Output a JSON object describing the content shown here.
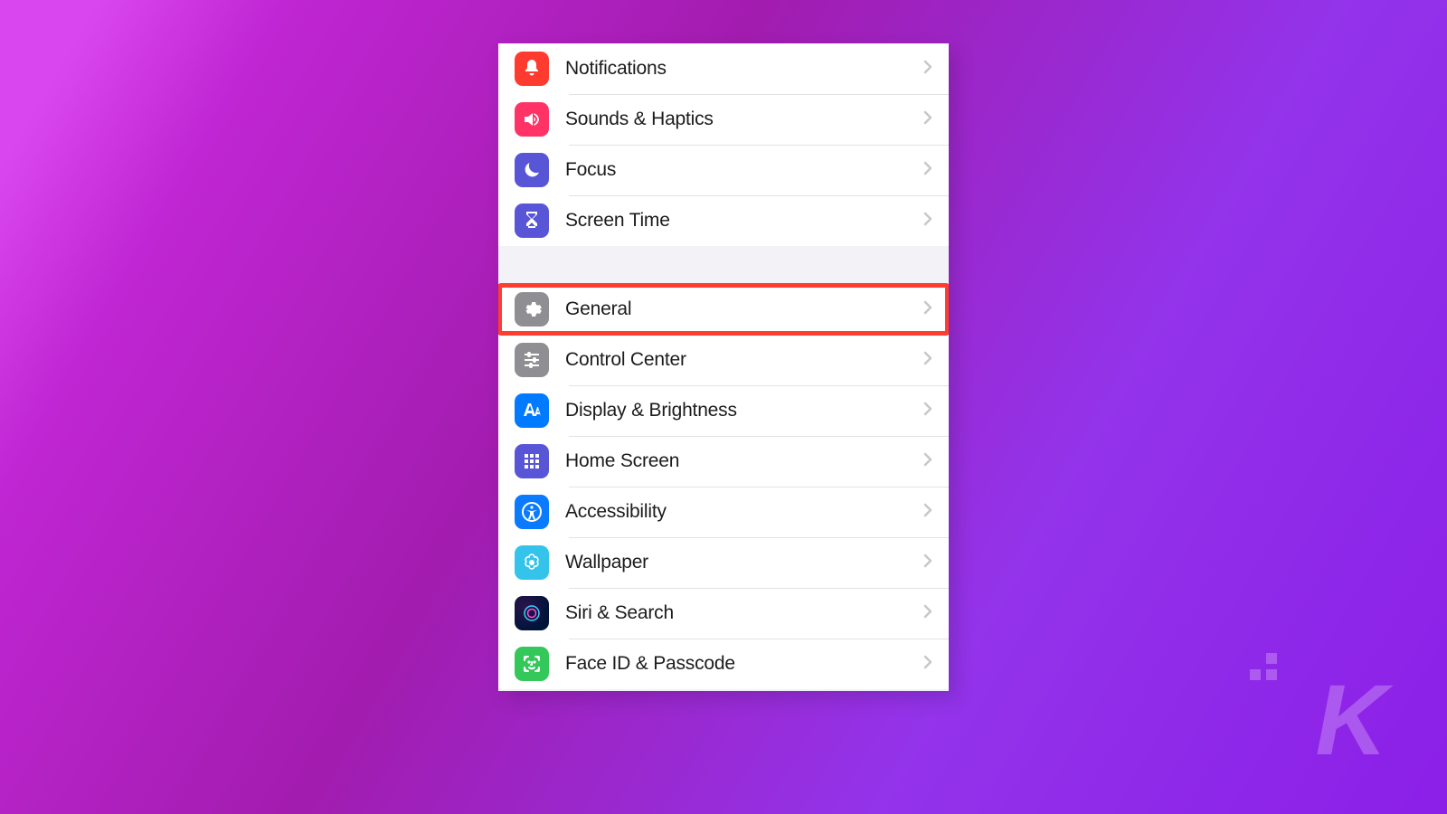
{
  "colors": {
    "highlight_outline": "#ff3d2e",
    "background_gradient_start": "#d946ef",
    "background_gradient_end": "#8b1fe8"
  },
  "settings": {
    "group1": [
      {
        "label": "Notifications",
        "icon": "bell-icon",
        "bg": "bg-red"
      },
      {
        "label": "Sounds & Haptics",
        "icon": "speaker-icon",
        "bg": "bg-pink"
      },
      {
        "label": "Focus",
        "icon": "moon-icon",
        "bg": "bg-indigo"
      },
      {
        "label": "Screen Time",
        "icon": "hourglass-icon",
        "bg": "bg-indigo"
      }
    ],
    "group2": [
      {
        "label": "General",
        "icon": "gear-icon",
        "bg": "bg-gray",
        "highlighted": true
      },
      {
        "label": "Control Center",
        "icon": "sliders-icon",
        "bg": "bg-gray"
      },
      {
        "label": "Display & Brightness",
        "icon": "text-size-icon",
        "bg": "bg-blue"
      },
      {
        "label": "Home Screen",
        "icon": "grid-icon",
        "bg": "bg-indigo"
      },
      {
        "label": "Accessibility",
        "icon": "accessibility-icon",
        "bg": "bg-access"
      },
      {
        "label": "Wallpaper",
        "icon": "flower-icon",
        "bg": "bg-wall"
      },
      {
        "label": "Siri & Search",
        "icon": "siri-icon",
        "bg": "bg-siri"
      },
      {
        "label": "Face ID & Passcode",
        "icon": "faceid-icon",
        "bg": "bg-green"
      }
    ]
  },
  "watermark": "K"
}
